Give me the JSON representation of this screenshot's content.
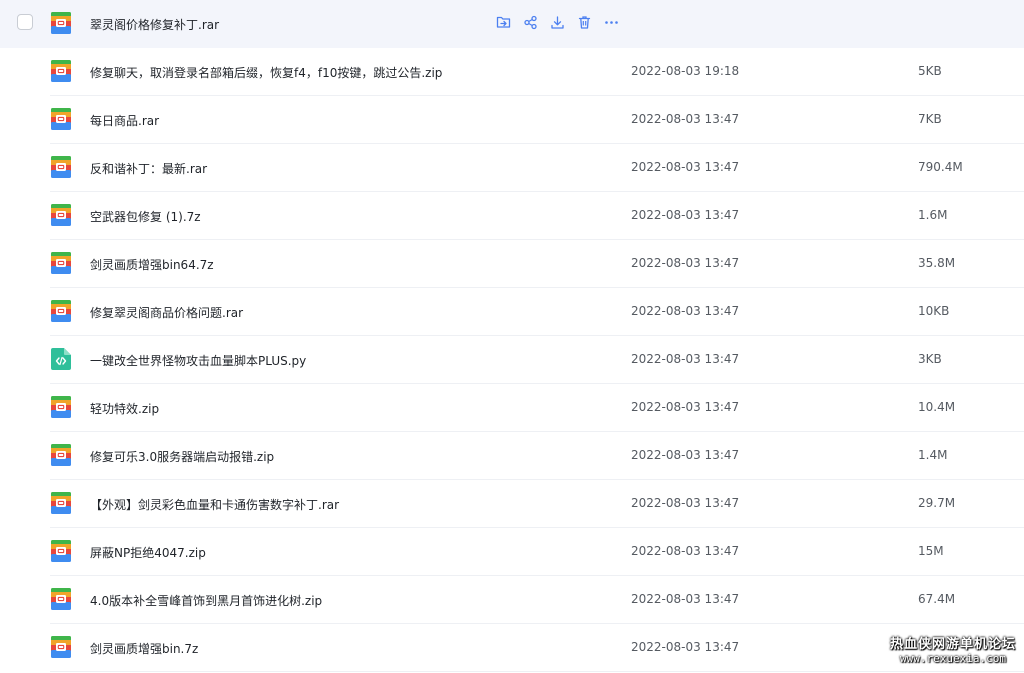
{
  "actions": [
    "move-icon",
    "share-icon",
    "download-icon",
    "delete-icon",
    "more-icon"
  ],
  "files": [
    {
      "name": "翠灵阁价格修复补丁.rar",
      "date": "",
      "size": "",
      "type": "archive"
    },
    {
      "name": "修复聊天，取消登录名部箱后缀，恢复f4，f10按键，跳过公告.zip",
      "date": "2022-08-03 19:18",
      "size": "5KB",
      "type": "archive"
    },
    {
      "name": "每日商品.rar",
      "date": "2022-08-03 13:47",
      "size": "7KB",
      "type": "archive"
    },
    {
      "name": "反和谐补丁：最新.rar",
      "date": "2022-08-03 13:47",
      "size": "790.4M",
      "type": "archive"
    },
    {
      "name": "空武器包修复 (1).7z",
      "date": "2022-08-03 13:47",
      "size": "1.6M",
      "type": "archive"
    },
    {
      "name": "剑灵画质增强bin64.7z",
      "date": "2022-08-03 13:47",
      "size": "35.8M",
      "type": "archive"
    },
    {
      "name": "修复翠灵阁商品价格问题.rar",
      "date": "2022-08-03 13:47",
      "size": "10KB",
      "type": "archive"
    },
    {
      "name": "一键改全世界怪物攻击血量脚本PLUS.py",
      "date": "2022-08-03 13:47",
      "size": "3KB",
      "type": "code"
    },
    {
      "name": "轻功特效.zip",
      "date": "2022-08-03 13:47",
      "size": "10.4M",
      "type": "archive"
    },
    {
      "name": "修复可乐3.0服务器端启动报错.zip",
      "date": "2022-08-03 13:47",
      "size": "1.4M",
      "type": "archive"
    },
    {
      "name": "【外观】剑灵彩色血量和卡通伤害数字补丁.rar",
      "date": "2022-08-03 13:47",
      "size": "29.7M",
      "type": "archive"
    },
    {
      "name": "屏蔽NP拒绝4047.zip",
      "date": "2022-08-03 13:47",
      "size": "15M",
      "type": "archive"
    },
    {
      "name": "4.0版本补全雪峰首饰到黑月首饰进化树.zip",
      "date": "2022-08-03 13:47",
      "size": "67.4M",
      "type": "archive"
    },
    {
      "name": "剑灵画质增强bin.7z",
      "date": "2022-08-03 13:47",
      "size": "",
      "type": "archive"
    }
  ],
  "watermark": {
    "line1": "热血侠网游单机论坛",
    "line2": "www.rexuexia.com"
  },
  "colors": {
    "hover_row": "#f3f5fb",
    "action_blue": "#4b7ff0",
    "code_icon": "#2fbf9a"
  }
}
